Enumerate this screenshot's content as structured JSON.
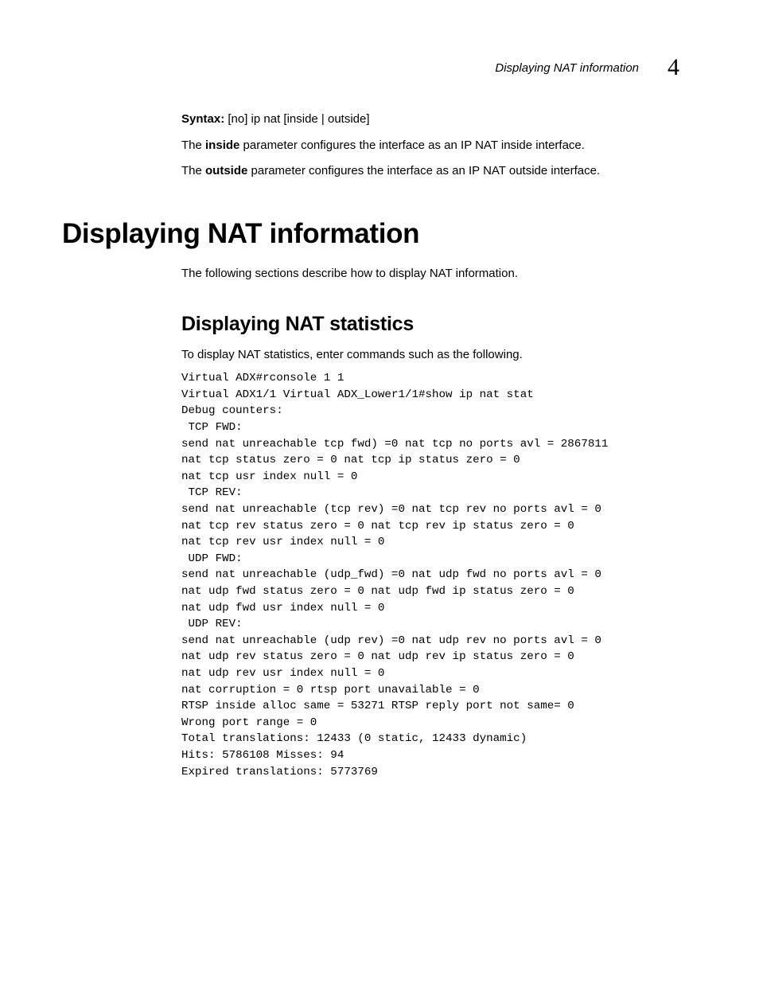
{
  "header": {
    "running_title": "Displaying NAT information",
    "chapter_number": "4"
  },
  "syntax_block": {
    "label": "Syntax:",
    "command": "[no] ip nat [inside | outside]"
  },
  "paragraphs": {
    "inside_pre": "The ",
    "inside_bold": "inside",
    "inside_post": " parameter configures the interface as an IP NAT inside interface.",
    "outside_pre": "The ",
    "outside_bold": "outside",
    "outside_post": " parameter configures the interface as an IP NAT outside interface.",
    "section_intro": "The following sections describe how to display NAT information.",
    "stats_intro": "To display NAT statistics, enter commands such as the following."
  },
  "headings": {
    "h1": "Displaying NAT information",
    "h2": "Displaying NAT statistics"
  },
  "code_block": "Virtual ADX#rconsole 1 1\nVirtual ADX1/1 Virtual ADX_Lower1/1#show ip nat stat\nDebug counters:\n TCP FWD:\nsend nat unreachable tcp fwd) =0 nat tcp no ports avl = 2867811\nnat tcp status zero = 0 nat tcp ip status zero = 0\nnat tcp usr index null = 0\n TCP REV:\nsend nat unreachable (tcp rev) =0 nat tcp rev no ports avl = 0\nnat tcp rev status zero = 0 nat tcp rev ip status zero = 0\nnat tcp rev usr index null = 0\n UDP FWD:\nsend nat unreachable (udp_fwd) =0 nat udp fwd no ports avl = 0\nnat udp fwd status zero = 0 nat udp fwd ip status zero = 0\nnat udp fwd usr index null = 0\n UDP REV:\nsend nat unreachable (udp rev) =0 nat udp rev no ports avl = 0\nnat udp rev status zero = 0 nat udp rev ip status zero = 0\nnat udp rev usr index null = 0\nnat corruption = 0 rtsp port unavailable = 0\nRTSP inside alloc same = 53271 RTSP reply port not same= 0\nWrong port range = 0\nTotal translations: 12433 (0 static, 12433 dynamic)\nHits: 5786108 Misses: 94\nExpired translations: 5773769"
}
